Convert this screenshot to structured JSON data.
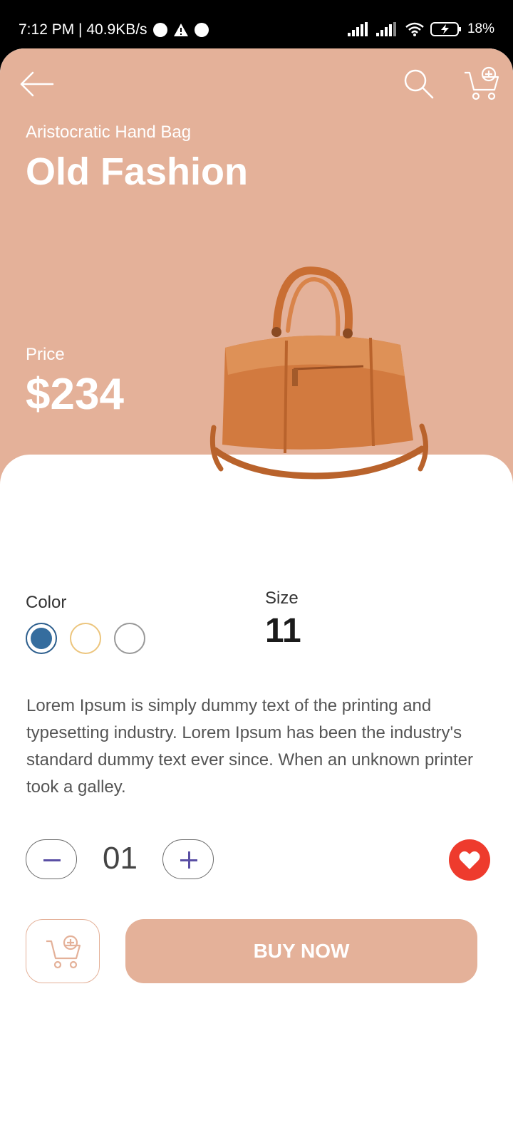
{
  "status_bar": {
    "time_speed": "7:12 PM | 40.9KB/s",
    "battery": "18%"
  },
  "header": {
    "back_icon": "arrow-left-icon",
    "search_icon": "search-icon",
    "cart_icon": "cart-plus-icon"
  },
  "product": {
    "subtitle": "Aristocratic Hand Bag",
    "title": "Old Fashion",
    "price_label": "Price",
    "price": "$234",
    "image_icon": "leather-duffel-bag-image"
  },
  "options": {
    "color_label": "Color",
    "colors": [
      "#356d9e",
      "#ecc57d",
      "#999999"
    ],
    "selected_color": "#356d9e",
    "size_label": "Size",
    "size": "11"
  },
  "description": "Lorem Ipsum is simply dummy text of the printing and typesetting industry. Lorem Ipsum has been the industry's standard dummy text ever since. When an unknown printer took a galley.",
  "quantity": {
    "value": "01"
  },
  "actions": {
    "buy_label": "BUY NOW",
    "favorite_icon": "heart-icon",
    "add_to_cart_icon": "cart-plus-icon"
  },
  "colors": {
    "accent": "#e4b199",
    "favorite": "#ee3b2d",
    "stepper_symbol": "#5a4fa4"
  }
}
